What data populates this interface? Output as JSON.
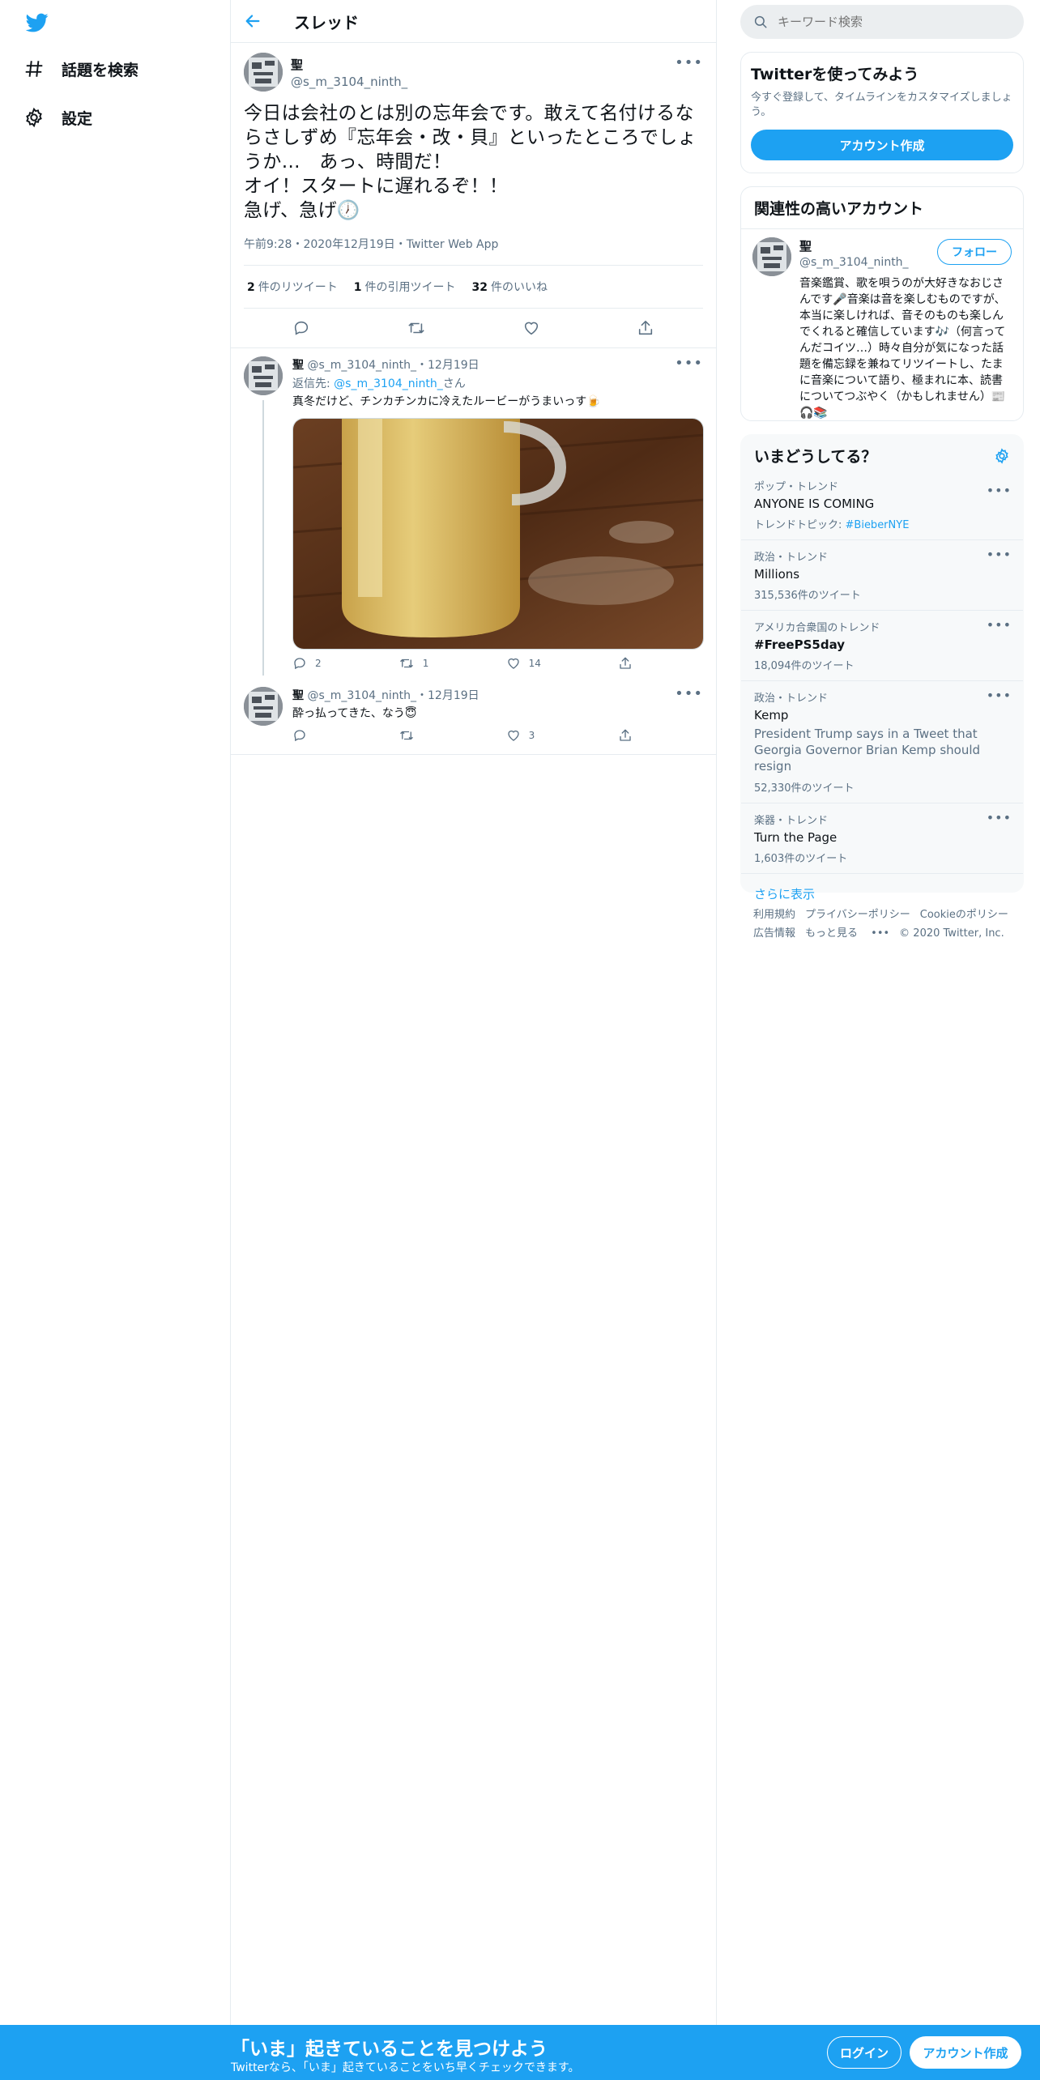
{
  "nav": {
    "explore_label": "話題を検索",
    "settings_label": "設定"
  },
  "thread": {
    "title": "スレッド"
  },
  "tweet": {
    "display_name": "聖",
    "handle": "@s_m_3104_ninth_",
    "text": "今日は会社のとは別の忘年会です。敢えて名付けるならさしずめ『忘年会・改・貝』といったところでしょうか…　あっ、時間だ！\nオイ！スタートに遅れるぞ！！\n急げ、急げ🕖",
    "meta": "午前9:28・2020年12月19日・Twitter Web App",
    "retweets_count": "2",
    "retweets_label": "件のリツイート",
    "quotes_count": "1",
    "quotes_label": "件の引用ツイート",
    "likes_count": "32",
    "likes_label": "件のいいね"
  },
  "replies": [
    {
      "display_name": "聖",
      "handle_date": "@s_m_3104_ninth_・12月19日",
      "replying_prefix": "返信先: ",
      "replying_to": "@s_m_3104_ninth_",
      "replying_suffix": "さん",
      "text": "真冬だけど、チンカチンカに冷えたルービーがうまいっす🍺",
      "reply_count": "2",
      "retweet_count": "1",
      "like_count": "14"
    },
    {
      "display_name": "聖",
      "handle_date": "@s_m_3104_ninth_・12月19日",
      "text": "酔っ払ってきた、なう😇",
      "reply_count": "",
      "retweet_count": "",
      "like_count": "3"
    }
  ],
  "search": {
    "placeholder": "キーワード検索"
  },
  "signup_card": {
    "title": "Twitterを使ってみよう",
    "subtitle": "今すぐ登録して、タイムラインをカスタマイズしましょう。",
    "button": "アカウント作成"
  },
  "related_card": {
    "title": "関連性の高いアカウント",
    "display_name": "聖",
    "handle": "@s_m_3104_ninth_",
    "follow": "フォロー",
    "bio": "音楽鑑賞、歌を唄うのが大好きなおじさんです🎤音楽は音を楽しむものですが、本当に楽しければ、音そのものも楽しんでくれると確信しています🎶（何言ってんだコイツ…）時々自分が気になった話題を備忘録を兼ねてリツイートし、たまに音楽について語り、極まれに本、読書についてつぶやく（かもしれません）📰🎧📚"
  },
  "trends": {
    "title": "いまどうしてる？",
    "items": [
      {
        "category": "ポップ・トレンド",
        "name": "ANYONE IS COMING",
        "sub_prefix": "トレンドトピック: ",
        "sub_link": "#BieberNYE"
      },
      {
        "category": "政治・トレンド",
        "name": "Millions",
        "sub": "315,536件のツイート"
      },
      {
        "category": "アメリカ合衆国のトレンド",
        "name": "#FreePS5day",
        "sub": "18,094件のツイート"
      },
      {
        "category": "政治・トレンド",
        "name": "Kemp",
        "desc": "President Trump says in a Tweet that Georgia Governor Brian Kemp should resign",
        "sub": "52,330件のツイート"
      },
      {
        "category": "楽器・トレンド",
        "name": "Turn the Page",
        "sub": "1,603件のツイート"
      }
    ],
    "show_more": "さらに表示"
  },
  "footer": {
    "terms": "利用規約",
    "privacy": "プライバシーポリシー",
    "cookie": "Cookieのポリシー",
    "ads": "広告情報",
    "more": "もっと見る",
    "copyright": "© 2020 Twitter, Inc."
  },
  "bottom_bar": {
    "title": "「いま」起きていることを見つけよう",
    "subtitle": "Twitterなら、「いま」起きていることをいち早くチェックできます。",
    "login": "ログイン",
    "signup": "アカウント作成"
  },
  "colors": {
    "brand": "#1da1f2",
    "text": "#0f1419",
    "secondary": "#5b7083"
  }
}
